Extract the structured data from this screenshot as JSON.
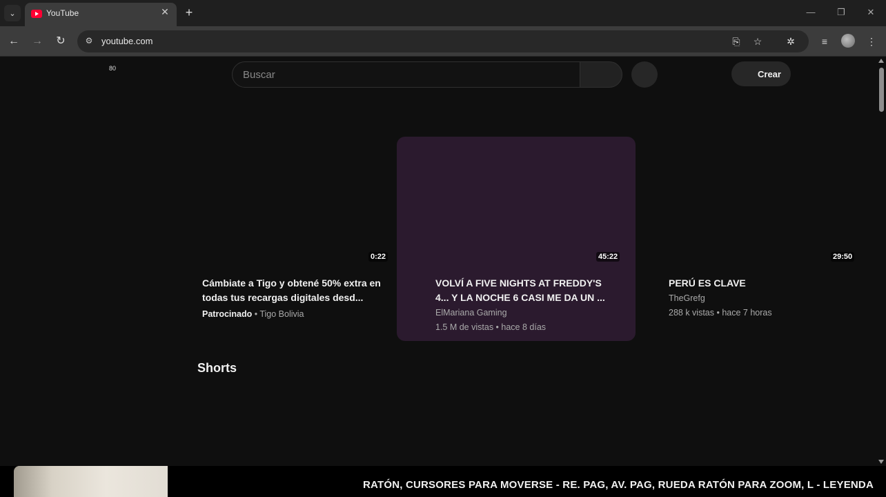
{
  "browser": {
    "tab_title": "YouTube",
    "url": "youtube.com",
    "icons": {
      "tab_search": "chevron-down-icon",
      "close": "close-icon",
      "new_tab": "plus-icon",
      "back": "back-arrow-icon",
      "forward": "forward-arrow-icon",
      "reload": "reload-icon",
      "site_info": "tune-icon",
      "install": "install-app-icon",
      "bookmark": "star-icon",
      "extensions": "puzzle-icon",
      "media": "media-queue-icon",
      "menu": "kebab-menu-icon"
    }
  },
  "youtube": {
    "notification_count": "80",
    "search_placeholder": "Buscar",
    "create_label": "Crear",
    "videos": [
      {
        "duration": "0:22",
        "title": "Cámbiate a Tigo y obtené 50% extra en todas tus recargas digitales desd...",
        "sponsored": "Patrocinado",
        "channel": "Tigo Bolivia"
      },
      {
        "duration": "45:22",
        "title": "VOLVÍ A FIVE NIGHTS AT FREDDY'S 4... Y LA NOCHE 6 CASI ME DA UN ...",
        "channel": "ElMariana Gaming",
        "stats": "1.5 M de vistas • hace 8 días"
      },
      {
        "duration": "29:50",
        "title": "PERÚ ES CLAVE",
        "channel": "TheGrefg",
        "stats": "288 k vistas • hace 7 horas"
      }
    ],
    "shorts_title": "Shorts"
  },
  "overlay": {
    "hint": "RATÓN, CURSORES PARA MOVERSE - RE. PAG, AV. PAG, RUEDA RATÓN PARA ZOOM, L - LEYENDA"
  },
  "colors": {
    "page_bg": "#0f0f0f",
    "hover_card": "#2b1a2e",
    "youtube_red": "#ff0033"
  }
}
